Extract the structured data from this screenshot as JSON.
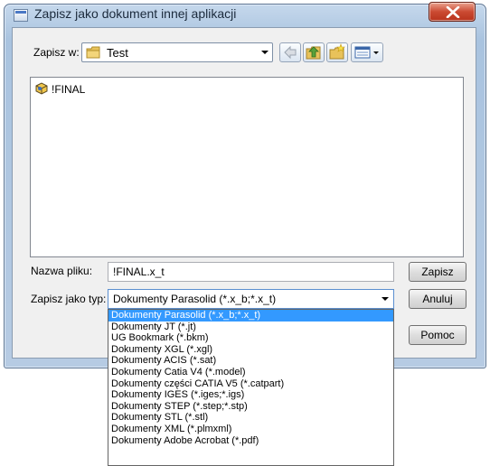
{
  "window": {
    "title": "Zapisz jako dokument innej aplikacji"
  },
  "save_in": {
    "label": "Zapisz w:",
    "value": "Test",
    "icon": "folder-icon"
  },
  "toolbar": {
    "back_icon": "back-arrow-icon",
    "up_icon": "folder-up-icon",
    "new_folder_icon": "new-folder-icon",
    "view_menu_icon": "view-menu-icon"
  },
  "file_list": {
    "items": [
      {
        "name": "!FINAL",
        "icon": "solidworks-assembly-icon"
      }
    ]
  },
  "file_name": {
    "label": "Nazwa pliku:",
    "value": "!FINAL.x_t"
  },
  "file_type": {
    "label": "Zapisz jako typ:",
    "value": "Dokumenty Parasolid (*.x_b;*.x_t)",
    "options": [
      "Dokumenty Parasolid (*.x_b;*.x_t)",
      "Dokumenty JT (*.jt)",
      "UG Bookmark (*.bkm)",
      "Dokumenty XGL (*.xgl)",
      "Dokumenty ACIS (*.sat)",
      "Dokumenty Catia V4 (*.model)",
      "Dokumenty części CATIA V5 (*.catpart)",
      "Dokumenty IGES (*.iges;*.igs)",
      "Dokumenty STEP (*.step;*.stp)",
      "Dokumenty STL (*.stl)",
      "Dokumenty XML (*.plmxml)",
      "Dokumenty Adobe Acrobat (*.pdf)"
    ],
    "selected_index": 0
  },
  "buttons": {
    "save": "Zapisz",
    "cancel": "Anuluj",
    "help": "Pomoc"
  },
  "colors": {
    "selection": "#3399ff",
    "close_button": "#cb4a32"
  }
}
